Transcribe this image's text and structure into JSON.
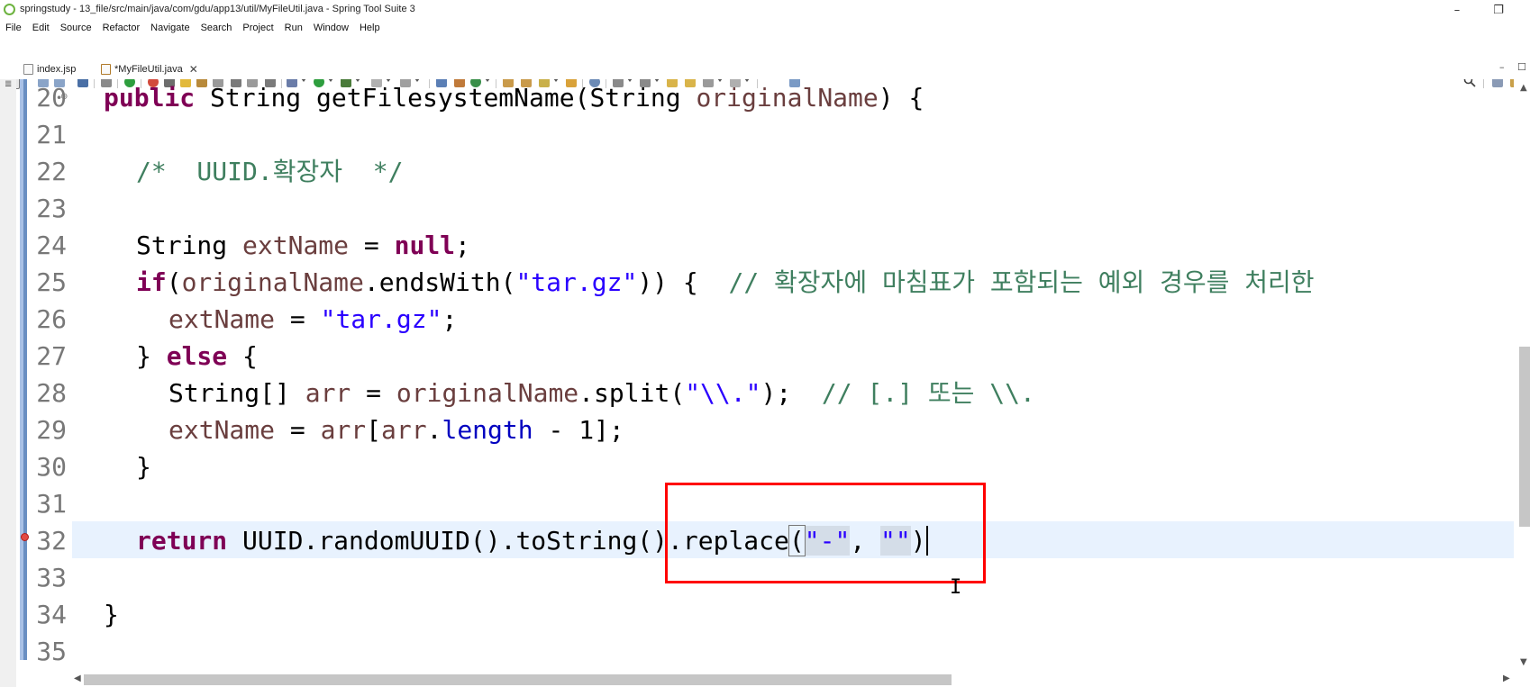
{
  "window": {
    "title": "springstudy - 13_file/src/main/java/com/gdu/app13/util/MyFileUtil.java - Spring Tool Suite 3",
    "minimize_icon": "minimize-icon",
    "restore_icon": "restore-icon"
  },
  "menu": [
    "File",
    "Edit",
    "Source",
    "Refactor",
    "Navigate",
    "Search",
    "Project",
    "Run",
    "Window",
    "Help"
  ],
  "tabs": [
    {
      "label": "index.jsp",
      "icon": "jsp-file-icon"
    },
    {
      "label": "*MyFileUtil.java",
      "icon": "java-file-icon"
    }
  ],
  "editor": {
    "line_numbers": [
      "20",
      "21",
      "22",
      "23",
      "24",
      "25",
      "26",
      "27",
      "28",
      "29",
      "30",
      "31",
      "32",
      "33",
      "34",
      "35"
    ],
    "lines": {
      "l20": {
        "kw1": "public",
        "t1": " String getFilesystemName(String ",
        "p1": "originalName",
        "t2": ") {"
      },
      "l22": {
        "c1": "/*  UUID.확장자  */"
      },
      "l24": {
        "t1": "String ",
        "v1": "extName",
        "t2": " = ",
        "kw1": "null",
        "t3": ";"
      },
      "l25": {
        "kw1": "if",
        "t1": "(",
        "v1": "originalName",
        "t2": ".endsWith(",
        "s1": "\"tar.gz\"",
        "t3": ")) {  ",
        "c1": "// 확장자에 마침표가 포함되는 예외 경우를 처리한"
      },
      "l26": {
        "v1": "extName",
        "t1": " = ",
        "s1": "\"tar.gz\"",
        "t2": ";"
      },
      "l27": {
        "t1": "} ",
        "kw1": "else",
        "t2": " {"
      },
      "l28": {
        "t1": "String[] ",
        "v1": "arr",
        "t2": " = ",
        "v2": "originalName",
        "t3": ".split(",
        "s1": "\"\\\\.\"",
        "t4": ");  ",
        "c1": "// [.] 또는 \\\\."
      },
      "l29": {
        "v1": "extName",
        "t1": " = ",
        "v2": "arr",
        "t2": "[",
        "v3": "arr",
        "t3": ".",
        "f1": "length",
        "t4": " - 1];"
      },
      "l30": {
        "t1": "}"
      },
      "l32": {
        "kw1": "return",
        "t1": " UUID.randomUUID().toString().replace",
        "t2": "(",
        "s1": "\"-\"",
        "t3": ", ",
        "s2": "\"\"",
        "t4": ")"
      },
      "l34": {
        "t1": "}"
      }
    }
  }
}
